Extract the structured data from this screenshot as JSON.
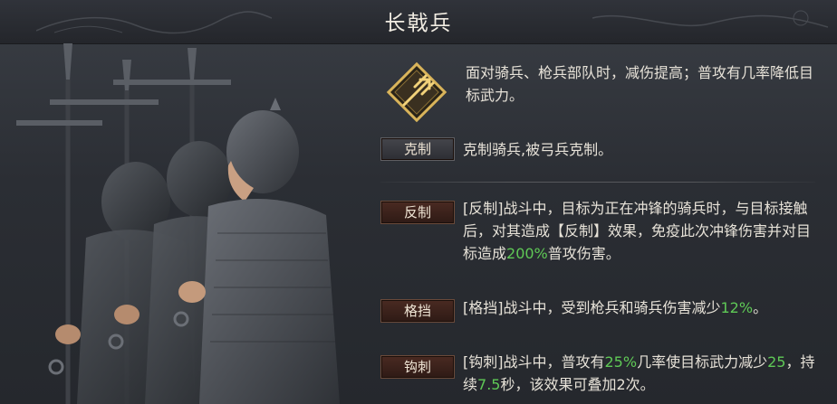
{
  "title": "长戟兵",
  "summary": "面对骑兵、枪兵部队时，减伤提高；普攻有几率降低目标武力。",
  "counter": {
    "label": "克制",
    "text": "克制骑兵,被弓兵克制。"
  },
  "skills": [
    {
      "label": "反制",
      "parts": [
        {
          "t": "[反制]战斗中，目标为正在冲锋的骑兵时，与目标接触后，对其造成【反制】效果，免疫此次冲锋伤害并对目标造成"
        },
        {
          "t": "200%",
          "hl": true
        },
        {
          "t": "普攻伤害。"
        }
      ]
    },
    {
      "label": "格挡",
      "parts": [
        {
          "t": "[格挡]战斗中，受到枪兵和骑兵伤害减少"
        },
        {
          "t": "12%",
          "hl": true
        },
        {
          "t": "。"
        }
      ]
    },
    {
      "label": "钩刺",
      "parts": [
        {
          "t": "[钩刺]战斗中，普攻有"
        },
        {
          "t": "25%",
          "hl": true
        },
        {
          "t": "几率使目标武力减少"
        },
        {
          "t": "25",
          "hl": true
        },
        {
          "t": "，持续"
        },
        {
          "t": "7.5",
          "hl": true
        },
        {
          "t": "秒，该效果可叠加2次。"
        }
      ]
    }
  ],
  "colors": {
    "highlight": "#5fc956",
    "tag_red": "#4a2a22",
    "tag_dark": "#45464c",
    "emblem_gold": "#d9b45a"
  },
  "icons": {
    "emblem": "trident-emblem-icon"
  }
}
